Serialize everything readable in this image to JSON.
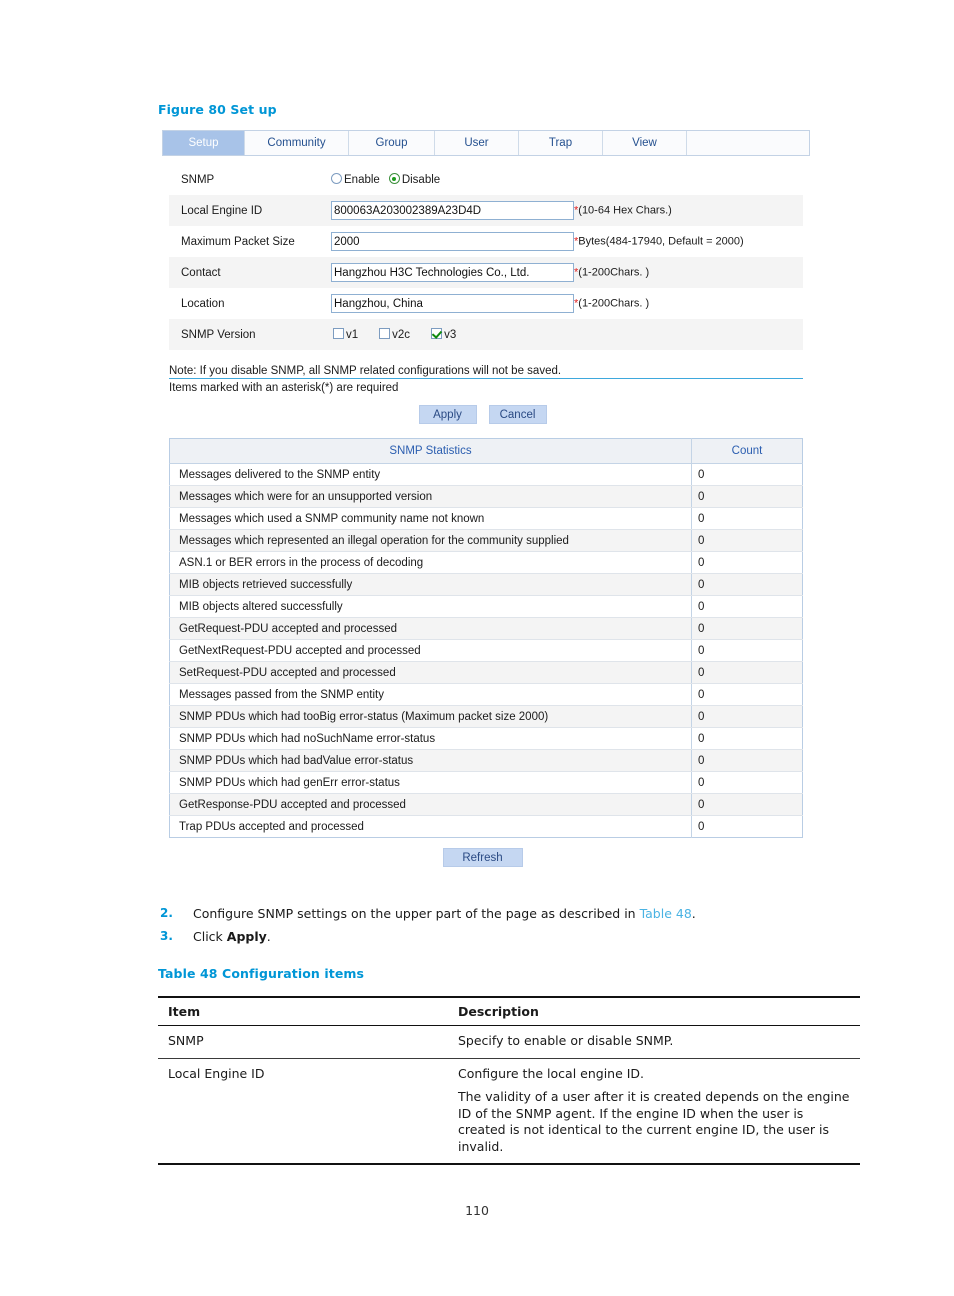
{
  "figure": {
    "caption": "Figure 80 Set up"
  },
  "webui": {
    "tabs": [
      {
        "label": "Setup",
        "active": true
      },
      {
        "label": "Community",
        "active": false
      },
      {
        "label": "Group",
        "active": false
      },
      {
        "label": "User",
        "active": false
      },
      {
        "label": "Trap",
        "active": false
      },
      {
        "label": "View",
        "active": false
      }
    ],
    "form": {
      "snmp": {
        "label": "SNMP",
        "options": [
          {
            "label": "Enable",
            "selected": false
          },
          {
            "label": "Disable",
            "selected": true
          }
        ]
      },
      "local_engine_id": {
        "label": "Local Engine ID",
        "value": "800063A203002389A23D4D",
        "required_mark": "*",
        "hint": "(10-64 Hex Chars.)"
      },
      "maximum_packet_size": {
        "label": "Maximum Packet Size",
        "value": "2000",
        "required_mark": "*",
        "hint": "Bytes(484-17940, Default = 2000)"
      },
      "contact": {
        "label": "Contact",
        "value": "Hangzhou H3C Technologies Co., Ltd.",
        "required_mark": "*",
        "hint": "(1-200Chars. )"
      },
      "location": {
        "label": "Location",
        "value": "Hangzhou, China",
        "required_mark": "*",
        "hint": "(1-200Chars. )"
      },
      "snmp_version": {
        "label": "SNMP Version",
        "options": [
          {
            "label": "v1",
            "checked": false
          },
          {
            "label": "v2c",
            "checked": false
          },
          {
            "label": "v3",
            "checked": true
          }
        ]
      }
    },
    "notes": {
      "line1": "Note: If you disable SNMP, all SNMP related configurations will not be saved.",
      "line2": "Items marked with an asterisk(*) are required"
    },
    "buttons": {
      "apply": "Apply",
      "cancel": "Cancel",
      "refresh": "Refresh"
    },
    "statistics": {
      "headers": [
        "SNMP Statistics",
        "Count"
      ],
      "rows": [
        {
          "name": "Messages delivered to the SNMP entity",
          "count": "0"
        },
        {
          "name": "Messages which were for an unsupported version",
          "count": "0"
        },
        {
          "name": "Messages which used a SNMP community name not known",
          "count": "0"
        },
        {
          "name": "Messages which represented an illegal operation for the community supplied",
          "count": "0"
        },
        {
          "name": "ASN.1 or BER errors in the process of decoding",
          "count": "0"
        },
        {
          "name": "MIB objects retrieved successfully",
          "count": "0"
        },
        {
          "name": "MIB objects altered successfully",
          "count": "0"
        },
        {
          "name": "GetRequest-PDU accepted and processed",
          "count": "0"
        },
        {
          "name": "GetNextRequest-PDU accepted and processed",
          "count": "0"
        },
        {
          "name": "SetRequest-PDU accepted and processed",
          "count": "0"
        },
        {
          "name": "Messages passed from the SNMP entity",
          "count": "0"
        },
        {
          "name": "SNMP PDUs which had tooBig error-status (Maximum packet size 2000)",
          "count": "0"
        },
        {
          "name": "SNMP PDUs which had noSuchName error-status",
          "count": "0"
        },
        {
          "name": "SNMP PDUs which had badValue error-status",
          "count": "0"
        },
        {
          "name": "SNMP PDUs which had genErr error-status",
          "count": "0"
        },
        {
          "name": "GetResponse-PDU accepted and processed",
          "count": "0"
        },
        {
          "name": "Trap PDUs accepted and processed",
          "count": "0"
        }
      ]
    }
  },
  "steps": [
    {
      "num": "2.",
      "text_before": "Configure SNMP settings on the upper part of the page as described in ",
      "link": "Table 48",
      "text_after": "."
    },
    {
      "num": "3.",
      "text_before": "Click ",
      "bold": "Apply",
      "text_after": "."
    }
  ],
  "config_table": {
    "caption": "Table 48 Configuration items",
    "headers": [
      "Item",
      "Description"
    ],
    "rows": [
      {
        "item": "SNMP",
        "description": [
          "Specify to enable or disable SNMP."
        ]
      },
      {
        "item": "Local Engine ID",
        "description": [
          "Configure the local engine ID.",
          "The validity of a user after it is created depends on the engine ID of the SNMP agent. If the engine ID when the user is created is not identical to the current engine ID, the user is invalid."
        ]
      }
    ]
  },
  "page_number": "110"
}
